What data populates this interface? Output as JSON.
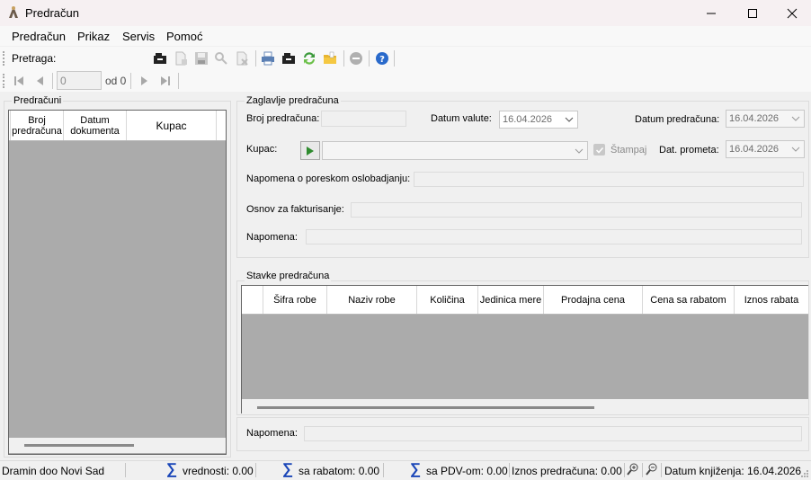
{
  "window": {
    "title": "Predračun",
    "buttons": {
      "minimize": "—",
      "maximize": "☐",
      "close": "✕"
    }
  },
  "menu": [
    "Predračun",
    "Prikaz",
    "Servis",
    "Pomoć"
  ],
  "toolbar": {
    "search_label": "Pretraga:",
    "search_value": "",
    "icons": [
      "open-folder-icon",
      "new-document-icon",
      "save-icon",
      "find-icon",
      "delete-document-icon",
      "print-icon",
      "print-preview-icon",
      "refresh-icon",
      "folder-icon",
      "cancel-icon",
      "help-icon"
    ]
  },
  "navigator": {
    "position": "0",
    "of_label": "od 0"
  },
  "left_panel": {
    "title": "Predračuni",
    "columns": [
      "Broj predračuna",
      "Datum dokumenta",
      "Kupac"
    ]
  },
  "header_group": {
    "title": "Zaglavlje predračuna",
    "broj_label": "Broj predračuna:",
    "broj_value": "",
    "datum_valute_label": "Datum valute:",
    "datum_valute_value": "16.04.2026",
    "datum_predracuna_label": "Datum predračuna:",
    "datum_predracuna_value": "16.04.2026",
    "kupac_label": "Kupac:",
    "kupac_value": "",
    "stampaj_label": "Štampaj",
    "dat_prometa_label": "Dat. prometa:",
    "dat_prometa_value": "16.04.2026",
    "napomena_pdv_label": "Napomena o poreskom oslobadjanju:",
    "osnov_label": "Osnov za fakturisanje:",
    "napomena_label": "Napomena:"
  },
  "items_group": {
    "title": "Stavke predračuna",
    "columns": [
      "Šifra robe",
      "Naziv robe",
      "Količina",
      "Jedinica mere",
      "Prodajna cena",
      "Cena sa rabatom",
      "Iznos rabata"
    ]
  },
  "bottom_note_label": "Napomena:",
  "status": {
    "company": "Dramin doo  Novi Sad",
    "vrednosti": "vrednosti: 0.00",
    "sa_rabatom": "sa rabatom:  0.00",
    "sa_pdv": "sa PDV-om:  0.00",
    "iznos": "Iznos predračuna:  0.00",
    "datum_knjizenja": "Datum knjiženja: 16.04.2026"
  },
  "colors": {
    "grid_bg": "#ababab",
    "sigma": "#1a46b8",
    "play_green": "#2e8b2e"
  }
}
